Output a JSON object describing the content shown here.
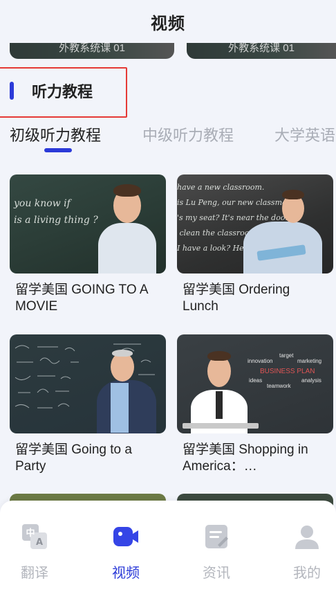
{
  "header": {
    "title": "视频"
  },
  "top_partial_cards": [
    {
      "caption": "外教系统课 01"
    },
    {
      "caption": "外教系统课 01"
    }
  ],
  "section": {
    "title": "听力教程"
  },
  "tabs": [
    {
      "label": "初级听力教程",
      "active": true
    },
    {
      "label": "中级听力教程",
      "active": false
    },
    {
      "label": "大学英语",
      "active": false
    }
  ],
  "cards": [
    {
      "title": "留学美国 GOING TO A MOVIE",
      "chalk": "you know if\nis a living thing ?"
    },
    {
      "title": "留学美国 Ordering Lunch",
      "chalk": "have a new classroom.\nis Lu Peng, our new classmate.\n's my seat? It's near the door.\n clean the classroom. Good idea!\nI have a look? Here you are."
    },
    {
      "title": "留学美国 Going to a Party",
      "chalk": ""
    },
    {
      "title": "留学美国 Shopping in America：Conversations",
      "chalk": ""
    }
  ],
  "business_words": [
    "innovation",
    "target",
    "marketing",
    "BUSINESS PLAN",
    "ideas",
    "teamwork",
    "analysis"
  ],
  "bottom_nav": [
    {
      "label": "翻译",
      "icon": "translate-icon",
      "active": false
    },
    {
      "label": "视频",
      "icon": "video-camera-icon",
      "active": true
    },
    {
      "label": "资讯",
      "icon": "news-icon",
      "active": false
    },
    {
      "label": "我的",
      "icon": "profile-icon",
      "active": false
    }
  ],
  "colors": {
    "accent": "#2b3ad8",
    "inactive": "#b3b6bd",
    "highlight_box": "#e53935"
  }
}
